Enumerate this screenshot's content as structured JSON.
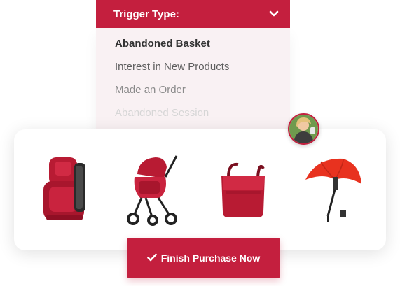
{
  "dropdown": {
    "label": "Trigger Type:",
    "options": [
      "Abandoned Basket",
      "Interest in New Products",
      "Made an Order",
      "Abandoned Session"
    ]
  },
  "icons": {
    "dropdown_toggle": "chevron-down-icon",
    "cta": "checkmark-icon"
  },
  "products": [
    {
      "icon": "car-seat"
    },
    {
      "icon": "stroller"
    },
    {
      "icon": "diaper-bag"
    },
    {
      "icon": "parasol"
    }
  ],
  "avatar": {
    "icon": "user-photo"
  },
  "cta": {
    "label": "Finish Purchase Now"
  },
  "colors": {
    "brand": "#c41f3e",
    "menu_bg": "#f9f1f3"
  }
}
